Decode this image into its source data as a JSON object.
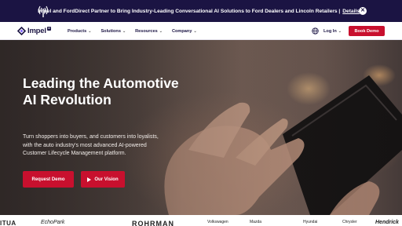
{
  "announcement": {
    "icon": "broadcast-icon",
    "text": "Impel and FordDirect Partner to Bring Industry-Leading Conversational AI Solutions to Ford Dealers and Lincoln Retailers |",
    "link_label": "Details",
    "close_icon": "close-icon"
  },
  "nav": {
    "logo_text": "Impel",
    "logo_badge": "AI",
    "menu": [
      {
        "label": "Products"
      },
      {
        "label": "Solutions"
      },
      {
        "label": "Resources"
      },
      {
        "label": "Company"
      }
    ],
    "globe_icon": "globe-icon",
    "login_label": "Log In",
    "cta_label": "Book Demo"
  },
  "hero": {
    "title": "Leading the Automotive AI Revolution",
    "description": "Turn shoppers into buyers, and customers into loyalists, with the auto industry's most advanced AI-powered Customer Lifecycle Management platform.",
    "primary_button": "Request Demo",
    "secondary_button": "Our Vision"
  },
  "partner_logos": [
    "ITUA",
    "EchoPark",
    "ROHRMAN",
    "Volkswagen",
    "Mazda",
    "Hyundai",
    "Chrysler",
    "Hendrick"
  ],
  "colors": {
    "accent": "#c8102e",
    "navy": "#1b1443"
  }
}
